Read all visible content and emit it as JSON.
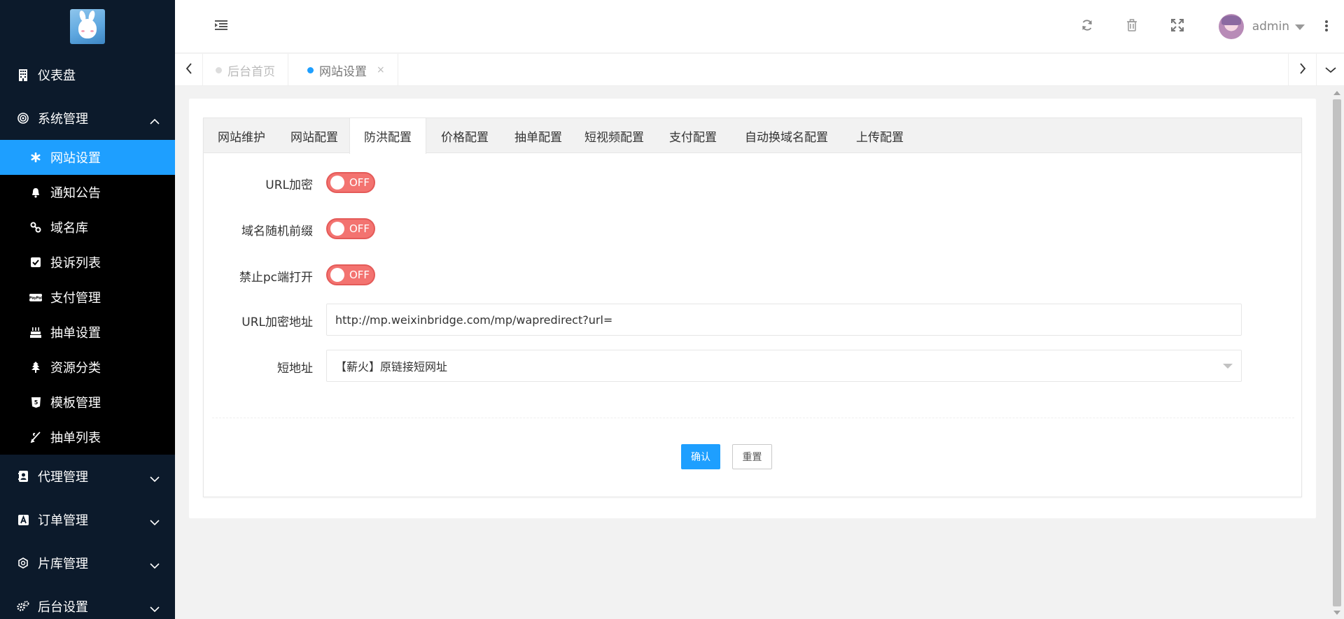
{
  "sidebar": {
    "logo_icon": "bunny-logo",
    "dashboard": {
      "label": "仪表盘",
      "icon": "building-icon"
    },
    "system": {
      "label": "系统管理",
      "icon": "target-icon",
      "expanded": true
    },
    "sub_items": [
      {
        "label": "网站设置",
        "icon": "gear-icon",
        "active": true
      },
      {
        "label": "通知公告",
        "icon": "bell-icon"
      },
      {
        "label": "域名库",
        "icon": "link-icon"
      },
      {
        "label": "投诉列表",
        "icon": "checkbox-icon"
      },
      {
        "label": "支付管理",
        "icon": "paypal-icon"
      },
      {
        "label": "抽单设置",
        "icon": "cake-icon"
      },
      {
        "label": "资源分类",
        "icon": "tree-icon"
      },
      {
        "label": "模板管理",
        "icon": "html5-icon"
      },
      {
        "label": "抽单列表",
        "icon": "pen-icon"
      }
    ],
    "agent": {
      "label": "代理管理",
      "icon": "contact-icon"
    },
    "orders": {
      "label": "订单管理",
      "icon": "font-icon"
    },
    "library": {
      "label": "片库管理",
      "icon": "hexagon-icon"
    },
    "backend": {
      "label": "后台设置",
      "icon": "gears-icon"
    },
    "colors": {
      "bg": "#0c1a2b",
      "submenu_bg": "#000000",
      "active": "#1e9fff"
    }
  },
  "header": {
    "toggle_icon": "indent-icon",
    "refresh_icon": "refresh-icon",
    "trash_icon": "trash-icon",
    "fullscreen_icon": "expand-icon",
    "user_name": "admin",
    "more_icon": "vertical-dots-icon"
  },
  "tabs_bar": {
    "tabs": [
      {
        "label": "后台首页",
        "active": false
      },
      {
        "label": "网站设置",
        "active": true,
        "close": "×"
      }
    ]
  },
  "settings": {
    "tabs": [
      "网站维护",
      "网站配置",
      "防洪配置",
      "价格配置",
      "抽单配置",
      "短视频配置",
      "支付配置",
      "自动换域名配置",
      "上传配置"
    ],
    "active_tab": "防洪配置",
    "fields": {
      "url_encrypt": {
        "label": "URL加密",
        "state": "OFF"
      },
      "domain_random_prefix": {
        "label": "域名随机前缀",
        "state": "OFF"
      },
      "block_pc": {
        "label": "禁止pc端打开",
        "state": "OFF"
      },
      "url_encrypt_address": {
        "label": "URL加密地址",
        "value": "http://mp.weixinbridge.com/mp/wapredirect?url="
      },
      "short_url": {
        "label": "短地址",
        "value": "【薪火】原链接短网址"
      }
    },
    "confirm_label": "确认",
    "reset_label": "重置",
    "colors": {
      "switch_off": "#f37370",
      "primary": "#1e9fff"
    }
  }
}
